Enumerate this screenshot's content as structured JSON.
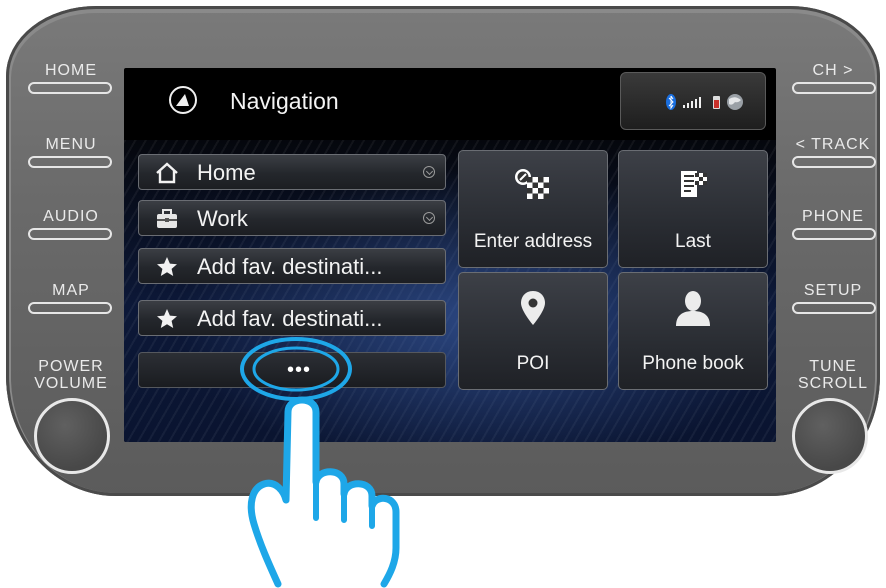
{
  "hardware": {
    "left_buttons": [
      "HOME",
      "MENU",
      "AUDIO",
      "MAP"
    ],
    "right_buttons": [
      "CH >",
      "< TRACK",
      "PHONE",
      "SETUP"
    ],
    "left_knob_label": [
      "POWER",
      "VOLUME"
    ],
    "right_knob_label": [
      "TUNE",
      "SCROLL"
    ]
  },
  "screen": {
    "title": "Navigation",
    "title_icon": "compass-icon",
    "status_icons": [
      "bluetooth-icon",
      "signal-bars-icon",
      "battery-icon",
      "globe-icon"
    ],
    "favorites": [
      {
        "label": "Home",
        "icon": "house-icon",
        "has_chevron": true
      },
      {
        "label": "Work",
        "icon": "briefcase-icon",
        "has_chevron": true
      },
      {
        "label": "Add fav. destinati...",
        "icon": "star-icon",
        "has_chevron": false
      },
      {
        "label": "Add fav. destinati...",
        "icon": "star-icon",
        "has_chevron": false
      }
    ],
    "more_label": "•••",
    "tiles": [
      {
        "label": "Enter address",
        "icon": "address-icon"
      },
      {
        "label": "Last",
        "icon": "recent-destinations-icon"
      },
      {
        "label": "POI",
        "icon": "map-pin-icon"
      },
      {
        "label": "Phone book",
        "icon": "contact-icon"
      }
    ]
  },
  "colors": {
    "bezel": "#6a6a6a",
    "highlight_ring": "#1ea7e8",
    "screen_accent": "#3a5fb0"
  },
  "overlay": {
    "pointer_icon": "tapping-hand-icon"
  }
}
